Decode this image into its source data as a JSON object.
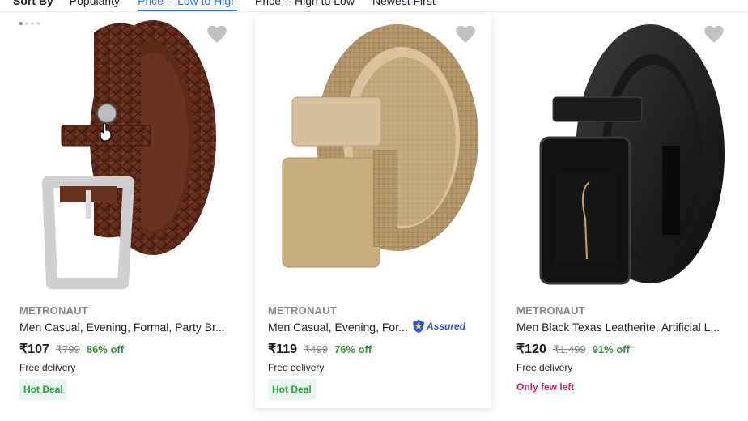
{
  "sort_bar": {
    "label": "Sort By",
    "options": [
      "Popularity",
      "Price -- Low to High",
      "Price -- High to Low",
      "Newest First"
    ],
    "active_index": 1
  },
  "products": [
    {
      "brand": "METRONAUT",
      "title": "Men Casual, Evening, Formal, Party Br...",
      "price": "₹107",
      "mrp": "₹799",
      "discount": "86% off",
      "delivery": "Free delivery",
      "badge": "Hot Deal",
      "image_icon": "brown-leather-belt-image",
      "assured": false
    },
    {
      "brand": "METRONAUT",
      "title": "Men Casual, Evening, For...",
      "price": "₹119",
      "mrp": "₹499",
      "discount": "76% off",
      "delivery": "Free delivery",
      "badge": "Hot Deal",
      "image_icon": "beige-canvas-belt-image",
      "assured": true,
      "assured_label": "Assured"
    },
    {
      "brand": "METRONAUT",
      "title": "Men Black Texas Leatherite, Artificial L...",
      "price": "₹120",
      "mrp": "₹1,499",
      "discount": "91% off",
      "delivery": "Free delivery",
      "urgency": "Only few left",
      "image_icon": "black-autolock-belt-image",
      "assured": false
    }
  ],
  "colors": {
    "accent": "#2874f0",
    "discount": "#388e3c",
    "badge_bg": "#e9f7ee",
    "badge_text": "#26a541",
    "urgency": "#d1256c",
    "assured": "#2a55e5"
  }
}
